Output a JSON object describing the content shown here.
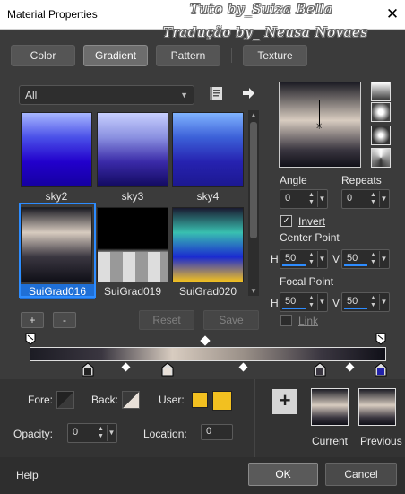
{
  "window": {
    "title": "Material Properties",
    "close": "✕"
  },
  "watermark": {
    "line1": "Tuto by_Suiza Bella",
    "line2": "Tradução by_ Neusa Novaes"
  },
  "tabs": [
    "Color",
    "Gradient",
    "Pattern",
    "Texture"
  ],
  "filter": {
    "value": "All"
  },
  "gradients": [
    {
      "name": "sky2",
      "colors": [
        "#a8b8ff",
        "#4a50e8",
        "#2200cc",
        "#1500a0"
      ]
    },
    {
      "name": "sky3",
      "colors": [
        "#c8d0ff",
        "#8a90e0",
        "#3a2aa8",
        "#120a60"
      ]
    },
    {
      "name": "sky4",
      "colors": [
        "#80b4ff",
        "#3c60d8",
        "#2622b0",
        "#1c1890"
      ]
    },
    {
      "name": "SuiGrad016",
      "colors": [
        "#1c1c24",
        "#d8ccc0",
        "#3a3640",
        "#101018"
      ]
    },
    {
      "name": "SuiGrad019",
      "colors": [
        "#000000",
        "#000000",
        "#c8c8c8",
        "#ffffff"
      ]
    },
    {
      "name": "SuiGrad020",
      "colors": [
        "#1a1a30",
        "#39c0b0",
        "#1a2ad0",
        "#f2c020"
      ]
    }
  ],
  "selected_gradient": "SuiGrad016",
  "buttons": {
    "add": "+",
    "remove": "-",
    "reset": "Reset",
    "save": "Save",
    "ok": "OK",
    "cancel": "Cancel",
    "help": "Help",
    "plus": "+"
  },
  "angle": {
    "label": "Angle",
    "value": "0"
  },
  "repeats": {
    "label": "Repeats",
    "value": "0"
  },
  "invert": {
    "label": "Invert",
    "checked": true
  },
  "center_point": {
    "label": "Center Point",
    "h_label": "H",
    "h": "50",
    "v_label": "V",
    "v": "50"
  },
  "focal_point": {
    "label": "Focal Point",
    "h_label": "H",
    "h": "50",
    "v_label": "V",
    "v": "50"
  },
  "link": {
    "label": "Link",
    "checked": false
  },
  "fore": {
    "label": "Fore:"
  },
  "back": {
    "label": "Back:"
  },
  "user": {
    "label": "User:",
    "color": "#f2c020"
  },
  "opacity": {
    "label": "Opacity:",
    "value": "0"
  },
  "location": {
    "label": "Location:",
    "value": "0"
  },
  "preview": {
    "current_label": "Current",
    "previous_label": "Previous"
  },
  "colors": {
    "accent": "#2d8cff",
    "selected_stop": "#2222aa"
  }
}
